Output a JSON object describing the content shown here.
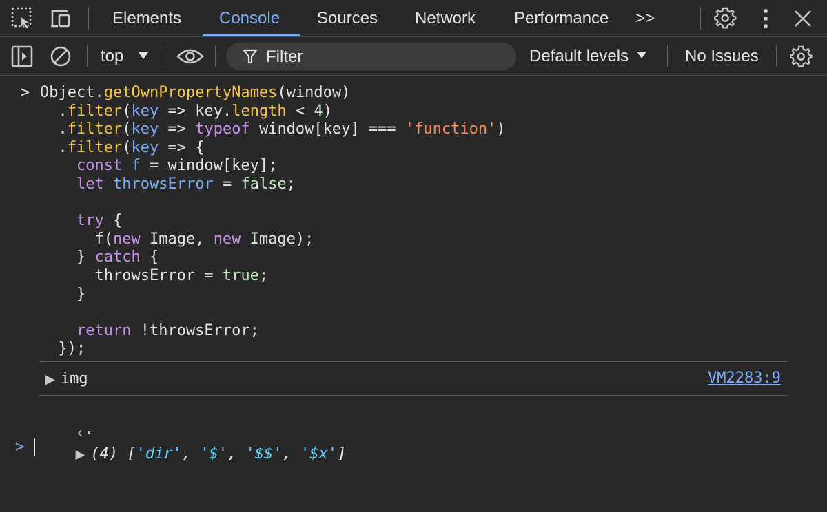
{
  "tabs": [
    {
      "label": "Elements",
      "active": false
    },
    {
      "label": "Console",
      "active": true
    },
    {
      "label": "Sources",
      "active": false
    },
    {
      "label": "Network",
      "active": false
    },
    {
      "label": "Performance",
      "active": false
    }
  ],
  "tab_overflow": ">>",
  "toolbar": {
    "context": "top",
    "filter_placeholder": "Filter",
    "levels": "Default levels",
    "issues": "No Issues"
  },
  "console": {
    "input_prompt": ">",
    "code_lines": [
      [
        [
          "Object.",
          ""
        ],
        [
          "getOwnPropertyNames",
          "fn"
        ],
        [
          "(window)",
          ""
        ]
      ],
      [
        [
          "  .",
          ""
        ],
        [
          "filter",
          "fn"
        ],
        [
          "(",
          ""
        ],
        [
          "key",
          "var"
        ],
        [
          " => key.",
          ""
        ],
        [
          "length",
          "fn"
        ],
        [
          " < ",
          ""
        ],
        [
          "4",
          "num"
        ],
        [
          ")",
          ""
        ]
      ],
      [
        [
          "  .",
          ""
        ],
        [
          "filter",
          "fn"
        ],
        [
          "(",
          ""
        ],
        [
          "key",
          "var"
        ],
        [
          " => ",
          ""
        ],
        [
          "typeof",
          "kw"
        ],
        [
          " window[key] === ",
          ""
        ],
        [
          "'function'",
          "str"
        ],
        [
          ")",
          ""
        ]
      ],
      [
        [
          "  .",
          ""
        ],
        [
          "filter",
          "fn"
        ],
        [
          "(",
          ""
        ],
        [
          "key",
          "var"
        ],
        [
          " => {",
          ""
        ]
      ],
      [
        [
          "    ",
          ""
        ],
        [
          "const",
          "kw"
        ],
        [
          " ",
          ""
        ],
        [
          "f",
          "var"
        ],
        [
          " = window[key];",
          ""
        ]
      ],
      [
        [
          "    ",
          ""
        ],
        [
          "let",
          "kw"
        ],
        [
          " ",
          ""
        ],
        [
          "throwsError",
          "var"
        ],
        [
          " = ",
          ""
        ],
        [
          "false",
          "lit"
        ],
        [
          ";",
          ""
        ]
      ],
      [
        [
          "",
          ""
        ]
      ],
      [
        [
          "    ",
          ""
        ],
        [
          "try",
          "kw"
        ],
        [
          " {",
          ""
        ]
      ],
      [
        [
          "      f(",
          ""
        ],
        [
          "new",
          "kw"
        ],
        [
          " Image, ",
          ""
        ],
        [
          "new",
          "kw"
        ],
        [
          " Image);",
          ""
        ]
      ],
      [
        [
          "    } ",
          ""
        ],
        [
          "catch",
          "kw"
        ],
        [
          " {",
          ""
        ]
      ],
      [
        [
          "      throwsError = ",
          ""
        ],
        [
          "true",
          "lit"
        ],
        [
          ";",
          ""
        ]
      ],
      [
        [
          "    }",
          ""
        ]
      ],
      [
        [
          "",
          ""
        ]
      ],
      [
        [
          "    ",
          ""
        ],
        [
          "return",
          "kw"
        ],
        [
          " !throwsError;",
          ""
        ]
      ],
      [
        [
          "  });",
          ""
        ]
      ]
    ],
    "log_label": "img",
    "log_source": "VM2283:9",
    "result_count": "(4)",
    "result_items": [
      "'dir'",
      "'$'",
      "'$$'",
      "'$x'"
    ],
    "result_return_glyph": "‹·",
    "next_prompt": ">"
  },
  "colors": {
    "background": "#282828",
    "accent": "#7cacf8",
    "function": "#f6c544",
    "keyword": "#c792ea",
    "string": "#f28b54",
    "result_string": "#5cd5fb"
  },
  "icons": [
    "inspect-element-icon",
    "device-toolbar-icon",
    "settings-gear-icon",
    "more-options-icon",
    "close-icon",
    "sidebar-toggle-icon",
    "clear-console-icon",
    "dropdown-triangle-icon",
    "live-expression-eye-icon",
    "filter-funnel-icon",
    "console-settings-gear-icon"
  ]
}
